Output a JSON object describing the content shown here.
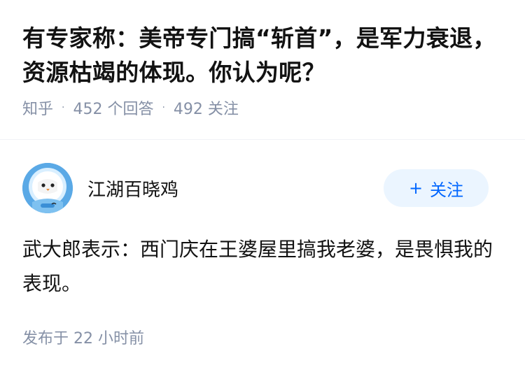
{
  "question": {
    "title": "有专家称：美帝专门搞“斩首”，是军力衰退，资源枯竭的体现。你认为呢？",
    "source": "知乎",
    "separator": "·",
    "answers_count": "452 个回答",
    "followers_count": "492 关注"
  },
  "answer": {
    "author": {
      "name": "江湖百晓鸡",
      "avatar_icon": "bird-astronaut-avatar"
    },
    "follow_button": {
      "plus": "+",
      "label": "关注"
    },
    "content": "武大郎表示：西门庆在王婆屋里搞我老婆，是畏惧我的表现。",
    "published": "发布于 22 小时前"
  },
  "colors": {
    "title": "#121212",
    "meta": "#8590a6",
    "follow_bg": "#ebf5ff",
    "follow_text": "#0066ff",
    "divider": "#f0f2f7",
    "avatar": "#5aa9e6"
  }
}
